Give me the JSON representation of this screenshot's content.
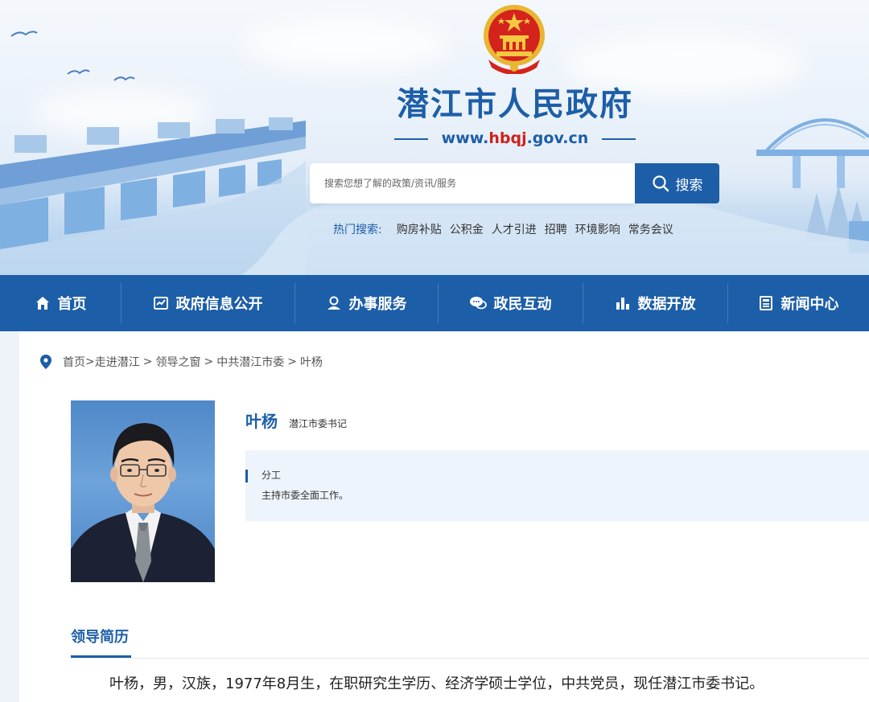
{
  "header": {
    "site_title": "潜江市人民政府",
    "site_url_prefix": "www.",
    "site_url_accent": "hbqj",
    "site_url_suffix": ".gov.cn",
    "search_placeholder": "搜索您想了解的政策/资讯/服务",
    "search_button": "搜索",
    "hot_label": "热门搜索:",
    "hot_items": [
      "购房补贴",
      "公积金",
      "人才引进",
      "招聘",
      "环境影响",
      "常务会议"
    ]
  },
  "nav": {
    "items": [
      {
        "label": "首页",
        "icon": "home-icon"
      },
      {
        "label": "政府信息公开",
        "icon": "info-doc-icon"
      },
      {
        "label": "办事服务",
        "icon": "user-service-icon"
      },
      {
        "label": "政民互动",
        "icon": "chat-icon"
      },
      {
        "label": "数据开放",
        "icon": "bar-chart-icon"
      },
      {
        "label": "新闻中心",
        "icon": "news-icon"
      }
    ]
  },
  "breadcrumb": {
    "items": [
      "首页",
      "走进潜江",
      "领导之窗",
      "中共潜江市委",
      "叶杨"
    ]
  },
  "profile": {
    "name": "叶杨",
    "position": "潜江市委书记",
    "duty_label": "分工",
    "duty_text": "主持市委全面工作。"
  },
  "resume": {
    "section_title": "领导简历",
    "text": "叶杨，男，汉族，1977年8月生，在职研究生学历、经济学硕士学位，中共党员，现任潜江市委书记。"
  },
  "colors": {
    "brand_blue": "#1d5ea8",
    "accent_red": "#d0211c",
    "duty_bg": "#eef4fb"
  }
}
